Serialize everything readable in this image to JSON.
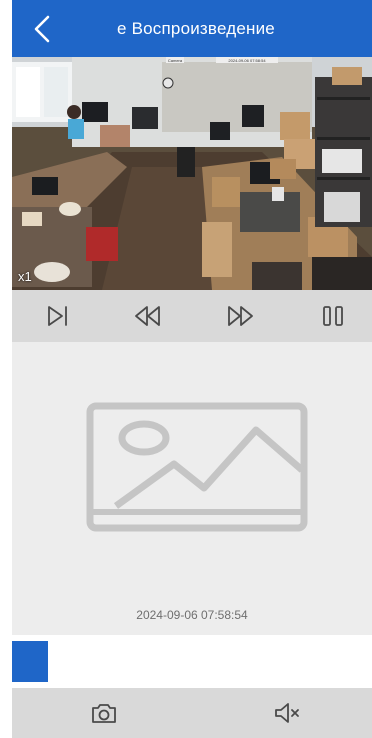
{
  "header": {
    "title": "е Воспроизведение",
    "back_icon": "chevron-left-icon",
    "bg_color": "#1f66c8"
  },
  "video": {
    "speed_label": "x1",
    "camera_label": "Camera",
    "overlay_time": "2024-09-06 07:58:54"
  },
  "controls": [
    {
      "icon": "step-forward-icon"
    },
    {
      "icon": "rewind-icon"
    },
    {
      "icon": "fast-forward-icon"
    },
    {
      "icon": "pause-icon"
    }
  ],
  "preview": {
    "icon": "image-placeholder-icon",
    "timestamp": "2024-09-06 07:58:54"
  },
  "timeline": {
    "progress": 0.1,
    "accent": "#1f66c8"
  },
  "bottombar": {
    "snapshot_icon": "camera-icon",
    "mute_icon": "speaker-muted-icon"
  }
}
